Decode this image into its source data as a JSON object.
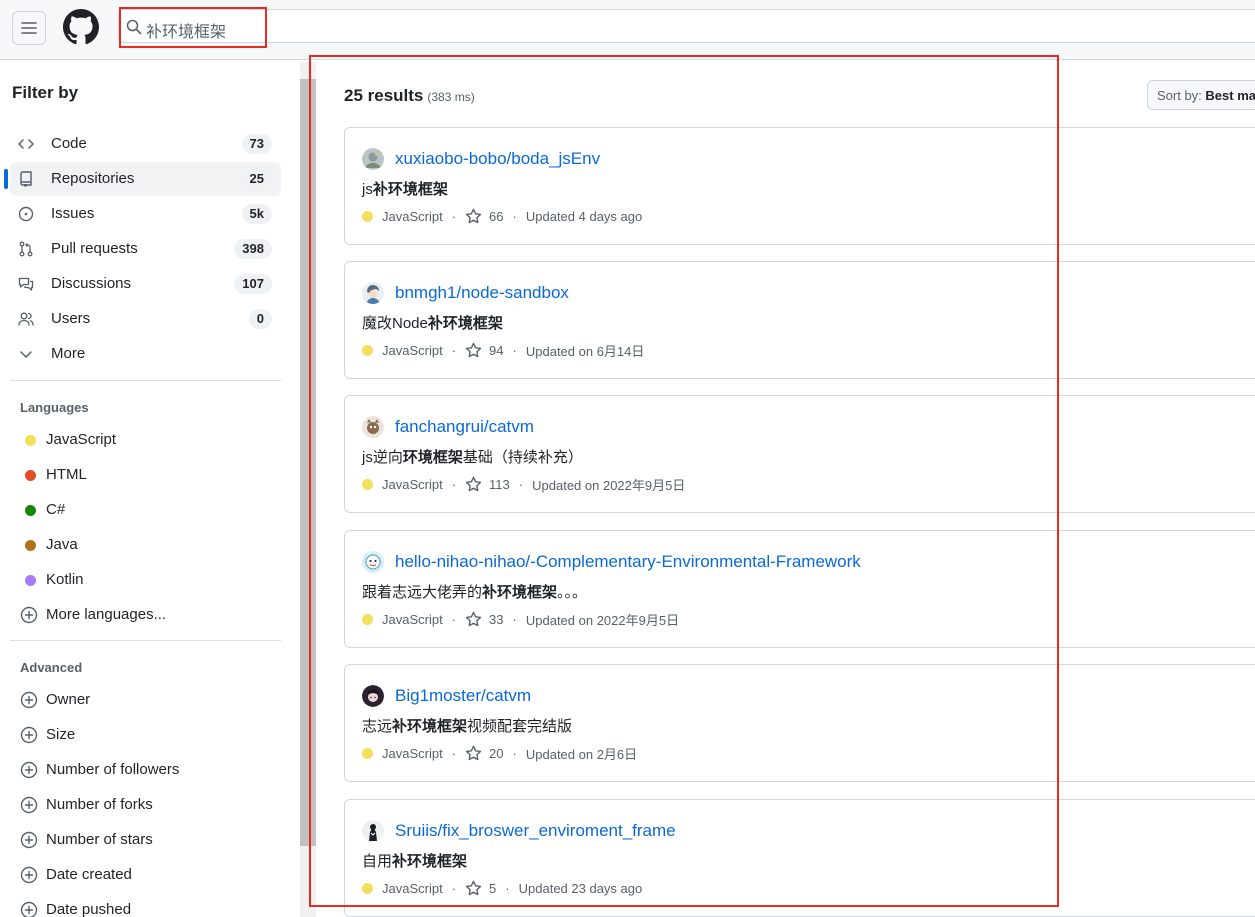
{
  "search": {
    "query": "补环境框架"
  },
  "sidebar": {
    "title": "Filter by",
    "nav": [
      {
        "label": "Code",
        "count": "73",
        "icon": "code-icon"
      },
      {
        "label": "Repositories",
        "count": "25",
        "icon": "repo-icon"
      },
      {
        "label": "Issues",
        "count": "5k",
        "icon": "issue-icon"
      },
      {
        "label": "Pull requests",
        "count": "398",
        "icon": "pull-request-icon"
      },
      {
        "label": "Discussions",
        "count": "107",
        "icon": "discussion-icon"
      },
      {
        "label": "Users",
        "count": "0",
        "icon": "people-icon"
      },
      {
        "label": "More",
        "icon": "chevron-down-icon"
      }
    ],
    "languages_title": "Languages",
    "languages": [
      {
        "label": "JavaScript",
        "color": "#f1e05a"
      },
      {
        "label": "HTML",
        "color": "#e34c26"
      },
      {
        "label": "C#",
        "color": "#178600"
      },
      {
        "label": "Java",
        "color": "#b07219"
      },
      {
        "label": "Kotlin",
        "color": "#A97BFF"
      }
    ],
    "more_languages": "More languages...",
    "advanced_title": "Advanced",
    "advanced": [
      "Owner",
      "Size",
      "Number of followers",
      "Number of forks",
      "Number of stars",
      "Date created",
      "Date pushed"
    ]
  },
  "results": {
    "count": "25 results",
    "time": "(383 ms)",
    "sort_label": "Sort by:",
    "sort_value": "Best match",
    "items": [
      {
        "name": "xuxiaobo-bobo/boda_jsEnv",
        "desc_pre": "js",
        "desc_bold": "补环境框架",
        "desc_post": "",
        "language": "JavaScript",
        "stars": "66",
        "updated": "Updated 4 days ago"
      },
      {
        "name": "bnmgh1/node-sandbox",
        "desc_pre": "魔改Node",
        "desc_bold": "补环境框架",
        "desc_post": "",
        "language": "JavaScript",
        "stars": "94",
        "updated": "Updated on 6月14日"
      },
      {
        "name": "fanchangrui/catvm",
        "desc_pre": "js逆向",
        "desc_bold": "环境框架",
        "desc_post": "基础（持续补充）",
        "language": "JavaScript",
        "stars": "113",
        "updated": "Updated on 2022年9月5日"
      },
      {
        "name": "hello-nihao-nihao/-Complementary-Environmental-Framework",
        "desc_pre": "跟着志远大佬弄的",
        "desc_bold": "补环境框架",
        "desc_post": "。。。",
        "language": "JavaScript",
        "stars": "33",
        "updated": "Updated on 2022年9月5日"
      },
      {
        "name": "Big1moster/catvm",
        "desc_pre": "志远",
        "desc_bold": "补环境框架",
        "desc_post": "视频配套完结版",
        "language": "JavaScript",
        "stars": "20",
        "updated": "Updated on 2月6日"
      },
      {
        "name": "Sruiis/fix_broswer_enviroment_frame",
        "desc_pre": "自用",
        "desc_bold": "补环境框架",
        "desc_post": "",
        "language": "JavaScript",
        "stars": "5",
        "updated": "Updated 23 days ago"
      }
    ]
  }
}
